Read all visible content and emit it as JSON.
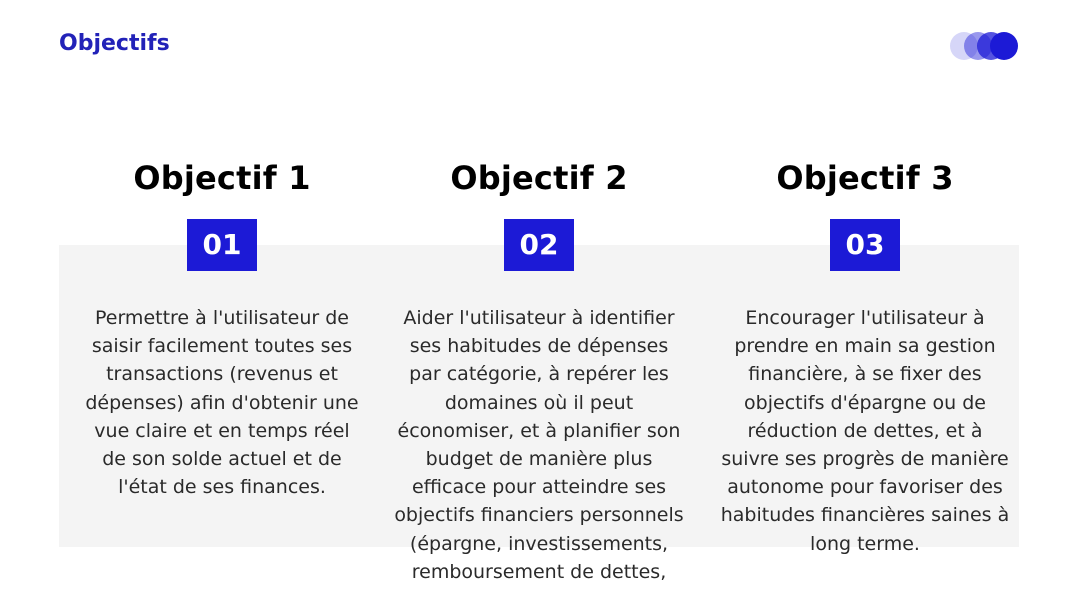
{
  "header": {
    "title": "Objectifs"
  },
  "colors": {
    "accent": "#1c1ad6",
    "title": "#2222b8",
    "panel": "#f4f4f4",
    "text": "#2a2a2a"
  },
  "objectives": [
    {
      "title": "Objectif 1",
      "number": "01",
      "text": "Permettre à l'utilisateur de saisir facilement toutes ses transactions (revenus et dépenses) afin d'obtenir une vue claire et en temps réel de son solde actuel et de l'état de ses finances."
    },
    {
      "title": "Objectif 2",
      "number": "02",
      "text": "Aider l'utilisateur à identifier ses habitudes de dépenses par catégorie, à repérer les domaines où il peut économiser, et à planifier son budget de manière plus efficace pour atteindre ses objectifs financiers personnels (épargne, investissements, remboursement de dettes,"
    },
    {
      "title": "Objectif 3",
      "number": "03",
      "text": "Encourager l'utilisateur à prendre en main sa gestion financière, à se fixer des objectifs d'épargne ou de réduction de dettes, et à suivre ses progrès de manière autonome pour favoriser des habitudes financières saines à long terme."
    }
  ]
}
